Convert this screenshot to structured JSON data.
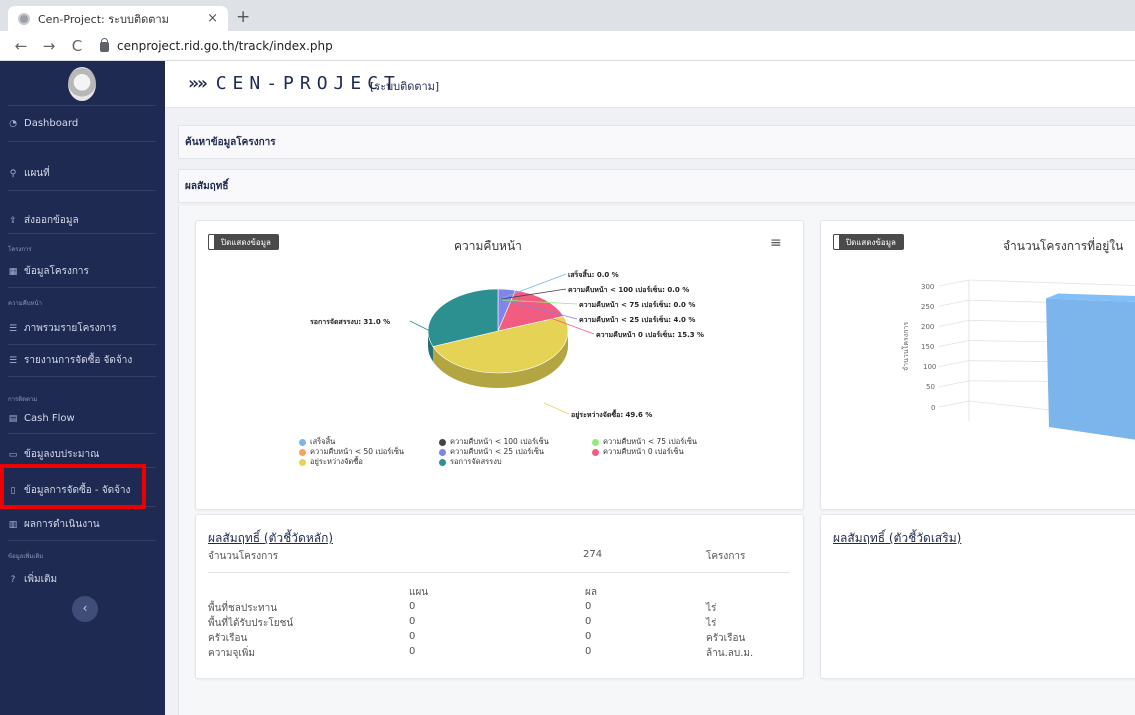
{
  "browser": {
    "tab_title": "Cen-Project: ระบบติดตาม",
    "tab_close": "×",
    "new_tab": "+",
    "back": "←",
    "forward": "→",
    "reload": "C",
    "url": "cenproject.rid.go.th/track/index.php"
  },
  "sidebar": {
    "collapse_icon": "‹",
    "items": [
      {
        "label": "Dashboard",
        "icon": "dashboard-icon"
      },
      {
        "label": "แผนที่",
        "icon": "map-pin-icon"
      },
      {
        "label": "ส่งออกข้อมูล",
        "icon": "export-icon"
      },
      {
        "label": "ข้อมูลโครงการ",
        "icon": "grid-icon"
      },
      {
        "label": "ภาพรวมรายโครงการ",
        "icon": "list-icon"
      },
      {
        "label": "รายงานการจัดซื้อ จัดจ้าง",
        "icon": "list-icon"
      },
      {
        "label": "Cash Flow",
        "icon": "cash-icon"
      },
      {
        "label": "ข้อมูลงบประมาณ",
        "icon": "money-icon"
      },
      {
        "label": "ข้อมูลการจัดซื้อ - จัดจ้าง",
        "icon": "document-icon"
      },
      {
        "label": "ผลการดำเนินงาน",
        "icon": "bar-icon"
      },
      {
        "label": "เพิ่มเติม",
        "icon": "help-icon"
      }
    ],
    "sections": [
      "โครงการ",
      "ความคืบหน้า",
      "การติดตาม",
      "ข้อมูลเพิ่มเติม"
    ]
  },
  "header": {
    "brand": "CEN-PROJECT",
    "brand_arrows": "»»",
    "subtitle": "[ระบบติดตาม]"
  },
  "panels": {
    "search": "ค้นหาข้อมูลโครงการ",
    "result": "ผลสัมฤทธิ์"
  },
  "pie_card": {
    "toggle_label": "ปิดแสดงข้อมูล",
    "title": "ความคืบหน้า",
    "menu_icon": "≡",
    "labels": [
      "เสร็จสิ้น: 0.0 %",
      "ความคืบหน้า < 100 เปอร์เซ็น: 0.0 %",
      "ความคืบหน้า < 75 เปอร์เซ็น: 0.0 %",
      "ความคืบหน้า < 25 เปอร์เซ็น: 4.0 %",
      "ความคืบหน้า 0 เปอร์เซ็น: 15.3 %",
      "รอการจัดสรรงบ: 31.0 %",
      "อยู่ระหว่างจัดซื้อ: 49.6 %"
    ],
    "legend": [
      {
        "label": "เสร็จสิ้น",
        "color": "#7cb5ec"
      },
      {
        "label": "ความคืบหน้า < 100 เปอร์เซ็น",
        "color": "#434348"
      },
      {
        "label": "ความคืบหน้า < 75 เปอร์เซ็น",
        "color": "#90ed7d"
      },
      {
        "label": "ความคืบหน้า < 50 เปอร์เซ็น",
        "color": "#f7a35c"
      },
      {
        "label": "ความคืบหน้า < 25 เปอร์เซ็น",
        "color": "#8085e9"
      },
      {
        "label": "ความคืบหน้า 0 เปอร์เซ็น",
        "color": "#f15c80"
      },
      {
        "label": "อยู่ระหว่างจัดซื้อ",
        "color": "#e4d354"
      },
      {
        "label": "รอการจัดสรรงบ",
        "color": "#2b908f"
      }
    ]
  },
  "bar_card": {
    "toggle_label": "ปิดแสดงข้อมูล",
    "title": "จำนวนโครงการที่อยู่ใน",
    "ylabel": "จำนวนโครงการ",
    "ticks": [
      "300",
      "250",
      "200",
      "150",
      "100",
      "50",
      "0"
    ]
  },
  "main_table": {
    "title": "ผลสัมฤทธิ์ (ตัวชี้วัดหลัก)",
    "count_label": "จำนวนโครงการ",
    "count_value": "274",
    "count_unit": "โครงการ",
    "col_plan": "แผน",
    "col_result": "ผล",
    "rows": [
      {
        "label": "พื้นที่ชลประทาน",
        "plan": "0",
        "result": "0",
        "unit": "ไร่"
      },
      {
        "label": "พื้นที่ได้รับประโยชน์",
        "plan": "0",
        "result": "0",
        "unit": "ไร่"
      },
      {
        "label": "ครัวเรือน",
        "plan": "0",
        "result": "0",
        "unit": "ครัวเรือน"
      },
      {
        "label": "ความจุเพิ่ม",
        "plan": "0",
        "result": "0",
        "unit": "ล้าน.ลบ.ม."
      }
    ]
  },
  "extra_table": {
    "title": "ผลสัมฤทธิ์ (ตัวชี้วัดเสริม)"
  },
  "chart_data": [
    {
      "type": "pie",
      "title": "ความคืบหน้า",
      "categories": [
        "เสร็จสิ้น",
        "ความคืบหน้า < 100 เปอร์เซ็น",
        "ความคืบหน้า < 75 เปอร์เซ็น",
        "ความคืบหน้า < 50 เปอร์เซ็น",
        "ความคืบหน้า < 25 เปอร์เซ็น",
        "ความคืบหน้า 0 เปอร์เซ็น",
        "อยู่ระหว่างจัดซื้อ",
        "รอการจัดสรรงบ"
      ],
      "values": [
        0.0,
        0.0,
        0.0,
        0.0,
        4.0,
        15.3,
        49.6,
        31.0
      ],
      "colors": [
        "#7cb5ec",
        "#434348",
        "#90ed7d",
        "#f7a35c",
        "#8085e9",
        "#f15c80",
        "#e4d354",
        "#2b908f"
      ],
      "legend": "bottom"
    },
    {
      "type": "bar",
      "title": "จำนวนโครงการที่อยู่ใน",
      "ylabel": "จำนวนโครงการ",
      "ylim": [
        0,
        300
      ],
      "values": [
        274
      ],
      "colors": [
        "#7cb5ec"
      ]
    }
  ]
}
